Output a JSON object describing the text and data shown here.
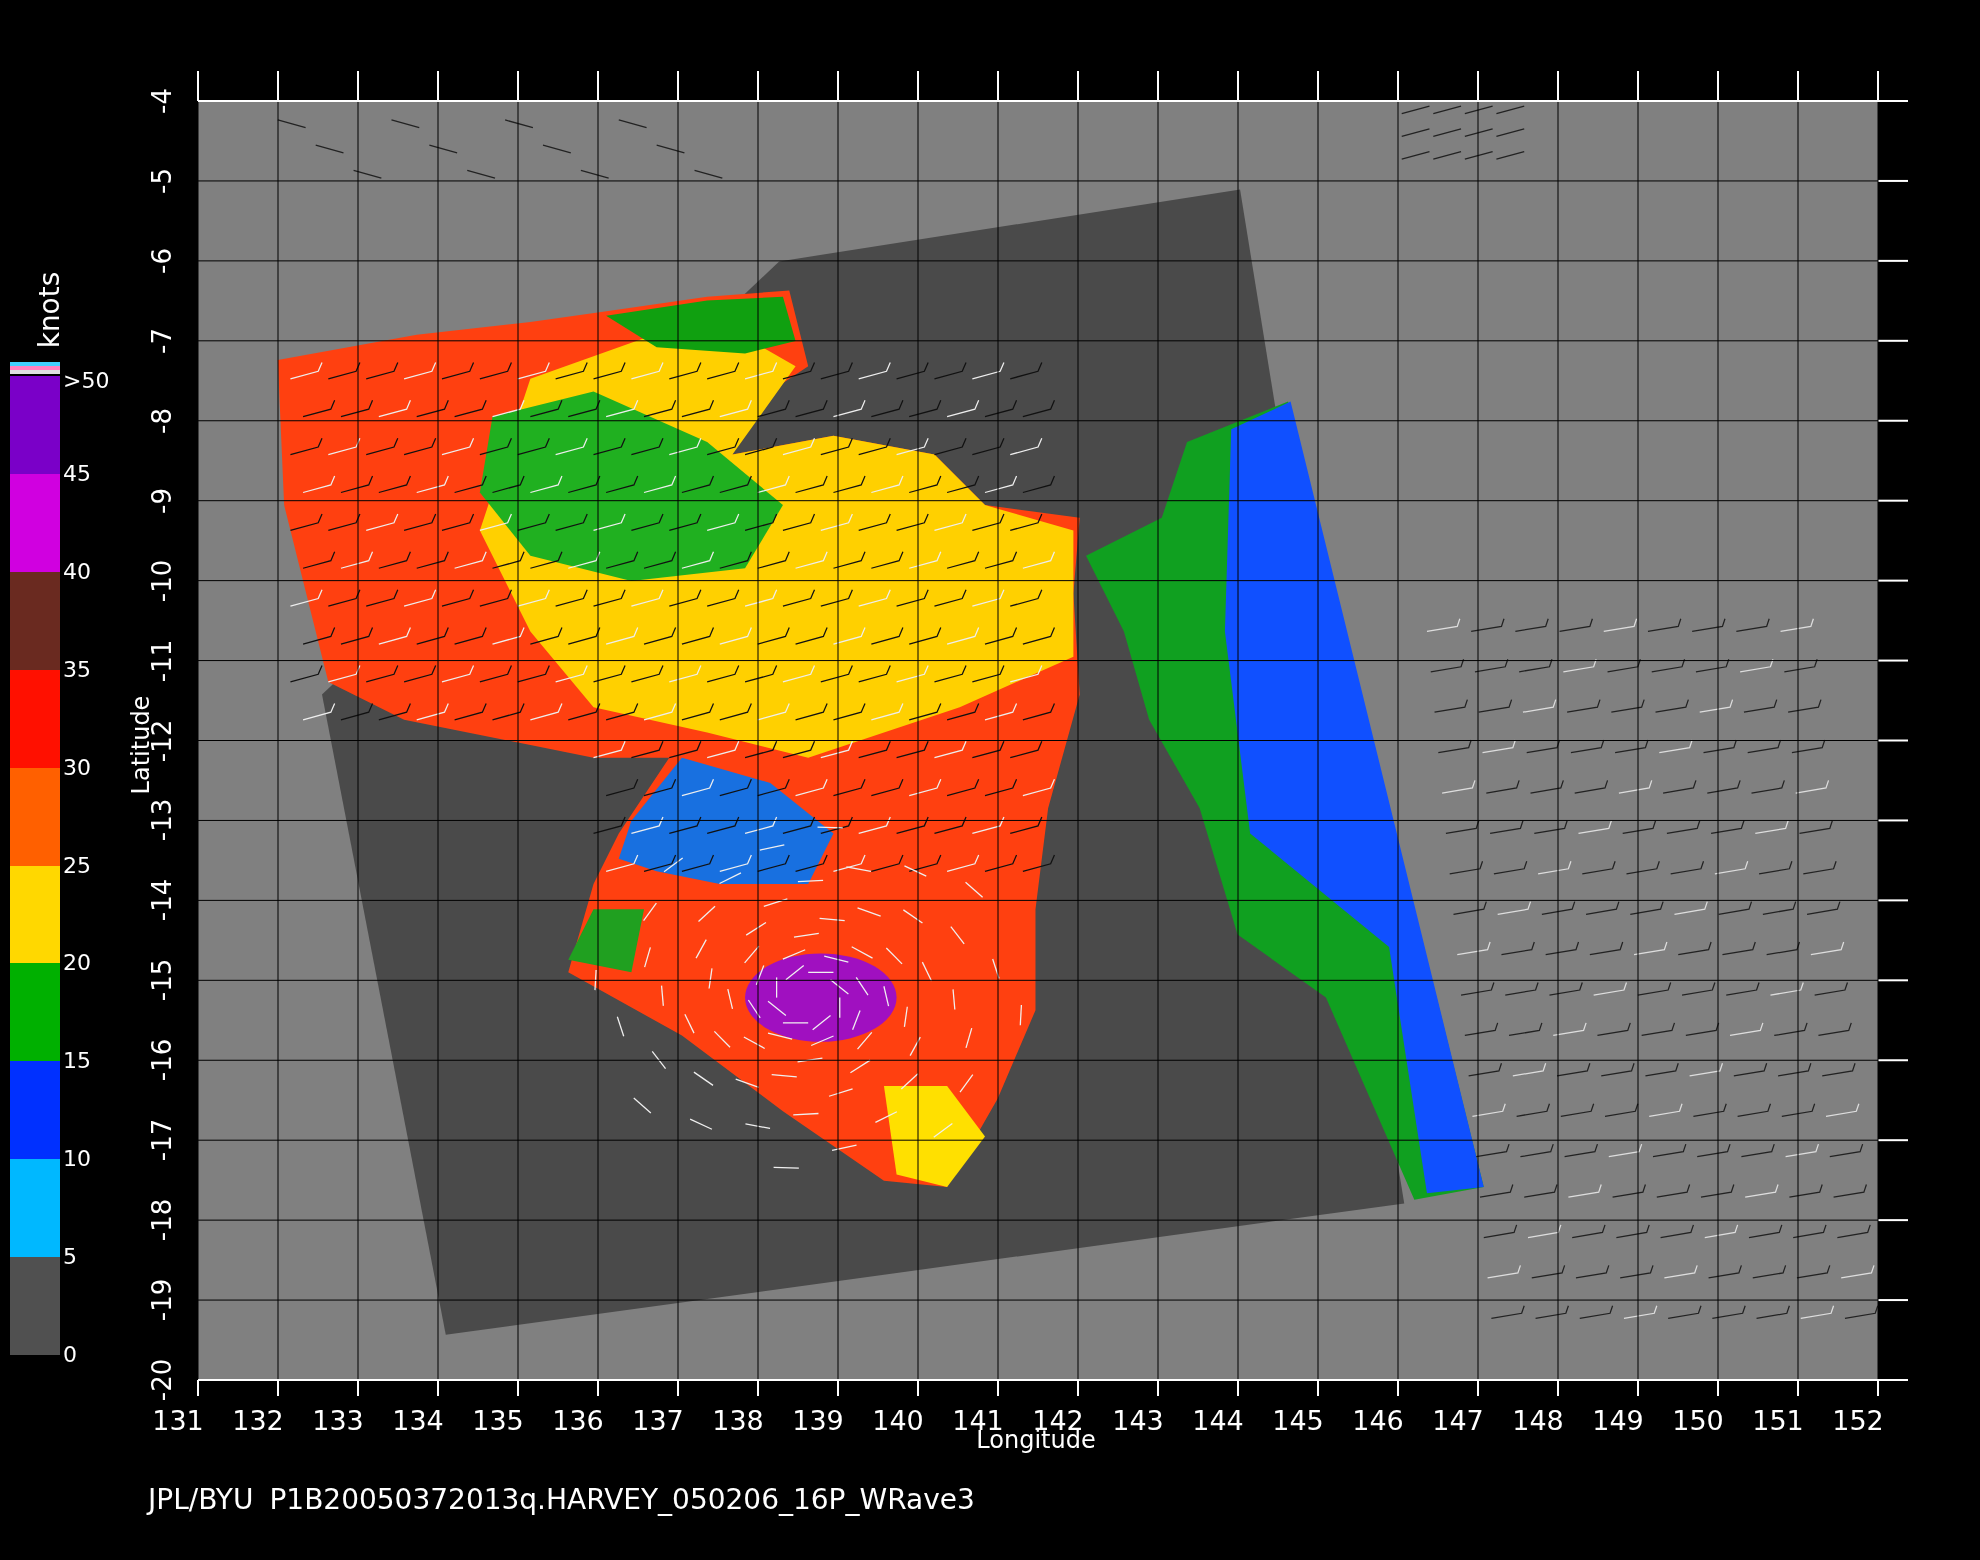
{
  "colorbar": {
    "unit": "knots",
    "labels": [
      ">50",
      "45",
      "40",
      "35",
      "30",
      "25",
      "20",
      "15",
      "10",
      "5",
      "0"
    ],
    "bands": [
      {
        "color": "#7a00c8"
      },
      {
        "color": "#d000e0"
      },
      {
        "color": "#6a2a20"
      },
      {
        "color": "#ff1000"
      },
      {
        "color": "#ff6000"
      },
      {
        "color": "#ffd800"
      },
      {
        "color": "#00b000"
      },
      {
        "color": "#0030ff"
      },
      {
        "color": "#00b8ff"
      },
      {
        "color": "#505050"
      }
    ]
  },
  "plot": {
    "y_axis": {
      "label": "Latitude",
      "ticks": [
        "-4",
        "-5",
        "-6",
        "-7",
        "-8",
        "-9",
        "-10",
        "-11",
        "-12",
        "-13",
        "-14",
        "-15",
        "-16",
        "-17",
        "-18",
        "-19",
        "-20"
      ]
    },
    "x_axis": {
      "label": "Longitude",
      "ticks": [
        "131",
        "132",
        "133",
        "134",
        "135",
        "136",
        "137",
        "138",
        "139",
        "140",
        "141",
        "142",
        "143",
        "144",
        "145",
        "146",
        "147",
        "148",
        "149",
        "150",
        "151",
        "152"
      ]
    }
  },
  "footer": {
    "source": "JPL/BYU",
    "file": "P1B20050372013q.HARVEY_050206_16P_WRave3"
  }
}
